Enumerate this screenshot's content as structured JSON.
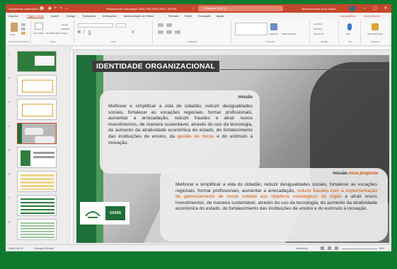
{
  "window": {
    "title_left": "Salvamento Automático",
    "doc_title": "Planejamento Estratégico SED PPA 2020-2023 - REVIS...",
    "search_placeholder": "Pesquisar (Alt+G)",
    "user": "Janea Almeida (Uno Zaine)"
  },
  "menu": {
    "tabs": [
      "Arquivo",
      "Página Inicial",
      "Inserir",
      "Design",
      "Transições",
      "Animações",
      "Apresentação de Slides",
      "Revisão",
      "Exibir",
      "Gravação",
      "Ajuda"
    ],
    "active": "Página Inicial",
    "share": "Compartilhar",
    "comments": "Comentários"
  },
  "ribbon": {
    "groups": [
      "Área de Transferência",
      "Slides",
      "Fonte",
      "Parágrafo",
      "Desenho",
      "Edição",
      "Voz",
      "Designer"
    ],
    "paste": "Colar",
    "new_slide": "Novo Slide",
    "reuse": "Reutilizar Slides",
    "layout": "Layout",
    "reset": "Redefinir",
    "section": "Seção",
    "arrange": "Organizar",
    "quick_styles": "Estilos Rápidos",
    "localizar": "Localizar",
    "substituir": "Substituir",
    "selecionar": "Selecionar",
    "ditar": "Ditar",
    "ideias": "Ideias de Design"
  },
  "slide": {
    "title": "IDENTIDADE ORGANIZACIONAL",
    "missao_heading": "missão",
    "missao_text_a": "Melhorar e simplificar a vida do cidadão, reduzir desigualdades sociais, fortalecer as vocações regionais, formar profissionais, aumentar a arrecadação, reduzir fraudes e atrair novos investimentos, de maneira sustentável, através do uso da tecnologia, do aumento da atratividade econômica do estado, do fortalecimento das instituições de ensino, da ",
    "missao_text_hl": "gestão de riscos",
    "missao_text_b": " e do estímulo à inovação.",
    "nova_heading_a": "missão ",
    "nova_heading_b": "nova proposta",
    "nova_text_a": "Melhorar e simplificar a vida do cidadão, reduzir desigualdades sociais, fortalecer as vocações regionais, formar profissionais, aumentar a arrecadação, ",
    "nova_text_hl": "reduzir fraudes com a implementação do gerenciamento de riscos voltado aos objetivos estratégicos do órgão",
    "nova_text_b": " e atrair novos investimentos, de maneira sustentável, através do uso da tecnologia, do aumento da atratividade econômica do estado, do fortalecimento das instituições de ensino e do estímulo à inovação.",
    "logo_text": "GOIÁS"
  },
  "thumbnails": [
    "1",
    "2",
    "3",
    "4",
    "5",
    "6",
    "7",
    "8"
  ],
  "selected_thumb": "4",
  "status": {
    "slide_info": "Slide 4 de 23",
    "language": "Português (Brasil)",
    "notes": "Anotações",
    "zoom": "83%"
  },
  "colors": {
    "accent": "#c4472a",
    "highlight": "#d35400",
    "green": "#1f6f3a",
    "background": "#0f7a2e"
  }
}
